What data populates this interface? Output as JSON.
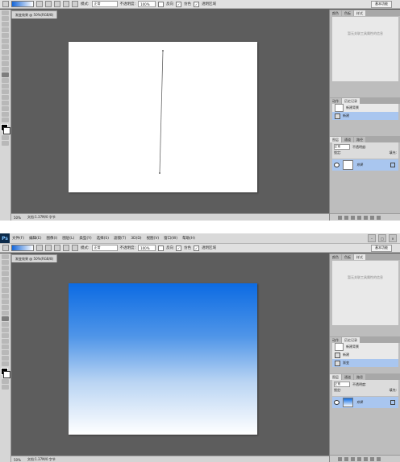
{
  "screens": [
    {
      "menus": [],
      "options": {
        "mode_label": "模式:",
        "mode_value": "正常",
        "opacity_label": "不透明度:",
        "opacity_value": "100%",
        "reverse_label": "反向",
        "dither_label": "仿色",
        "transparency_label": "透明区域"
      },
      "workspace_button": "基本功能",
      "doc_tab": "渐变效果 @ 50%(RGB/8)",
      "zoom": "50%",
      "doc_size": "文档:1.37M/0 字节",
      "panel_tabs_top": [
        "颜色",
        "色板",
        "样式"
      ],
      "info_placeholder": "暂无关联工具属性的信息",
      "history_tabs": [
        "动作",
        "历史记录"
      ],
      "history_items": [
        "新建背景",
        "新建"
      ],
      "layer_tabs": [
        "图层",
        "通道",
        "路径"
      ],
      "blend_mode": "正常",
      "lock_label": "锁定:",
      "fill_label": "填充:",
      "opacity_short": "不透明度:",
      "layer_name": "背景",
      "canvas_fill": "white",
      "guide_line": true
    },
    {
      "menus": [
        "文件(F)",
        "编辑(E)",
        "图像(I)",
        "图层(L)",
        "类型(Y)",
        "选择(S)",
        "滤镜(T)",
        "3D(D)",
        "视图(V)",
        "窗口(W)",
        "帮助(H)"
      ],
      "options": {
        "mode_label": "模式:",
        "mode_value": "正常",
        "opacity_label": "不透明度:",
        "opacity_value": "100%",
        "reverse_label": "反向",
        "dither_label": "仿色",
        "transparency_label": "透明区域"
      },
      "workspace_button": "基本功能",
      "doc_tab": "渐变效果 @ 50%(RGB/8)",
      "zoom": "50%",
      "doc_size": "文档:1.37M/0 字节",
      "panel_tabs_top": [
        "颜色",
        "色板",
        "样式"
      ],
      "info_placeholder": "暂无关联工具属性的信息",
      "history_tabs": [
        "动作",
        "历史记录"
      ],
      "history_items": [
        "新建背景",
        "新建",
        "渐变"
      ],
      "layer_tabs": [
        "图层",
        "通道",
        "路径"
      ],
      "blend_mode": "正常",
      "lock_label": "锁定:",
      "fill_label": "填充:",
      "opacity_short": "不透明度:",
      "layer_name": "背景",
      "canvas_fill": "gradient",
      "gradient_colors": [
        "#0c6be3",
        "#ffffff"
      ],
      "guide_line": false
    }
  ]
}
